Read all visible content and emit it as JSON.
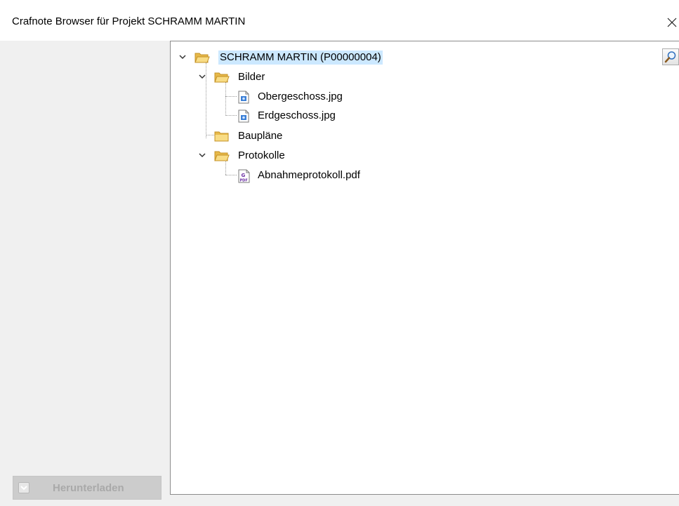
{
  "window": {
    "title": "Crafnote Browser für Projekt SCHRAMM MARTIN",
    "close_icon": "close-icon"
  },
  "left_panel": {
    "download_button": {
      "label": "Herunterladen",
      "icon": "chevron-down-icon",
      "enabled": false
    }
  },
  "tree": {
    "search_icon": "magnifier-icon",
    "root": {
      "label": "SCHRAMM MARTIN (P00000004)",
      "icon": "folder-open-icon",
      "expanded": true,
      "selected": true
    },
    "bilder": {
      "label": "Bilder",
      "icon": "folder-open-icon",
      "expanded": true
    },
    "obergeschoss": {
      "label": "Obergeschoss.jpg",
      "icon": "image-file-icon"
    },
    "erdgeschoss": {
      "label": "Erdgeschoss.jpg",
      "icon": "image-file-icon"
    },
    "bauplaene": {
      "label": "Baupläne",
      "icon": "folder-icon"
    },
    "protokolle": {
      "label": "Protokolle",
      "icon": "folder-open-icon",
      "expanded": true
    },
    "abnahme": {
      "label": "Abnahmeprotokoll.pdf",
      "icon": "pdf-file-icon"
    }
  },
  "colors": {
    "selection": "#cce8ff",
    "folder": "#f5cf6a",
    "disabled_text": "#a9a9a9",
    "disabled_button": "#cccccc"
  }
}
